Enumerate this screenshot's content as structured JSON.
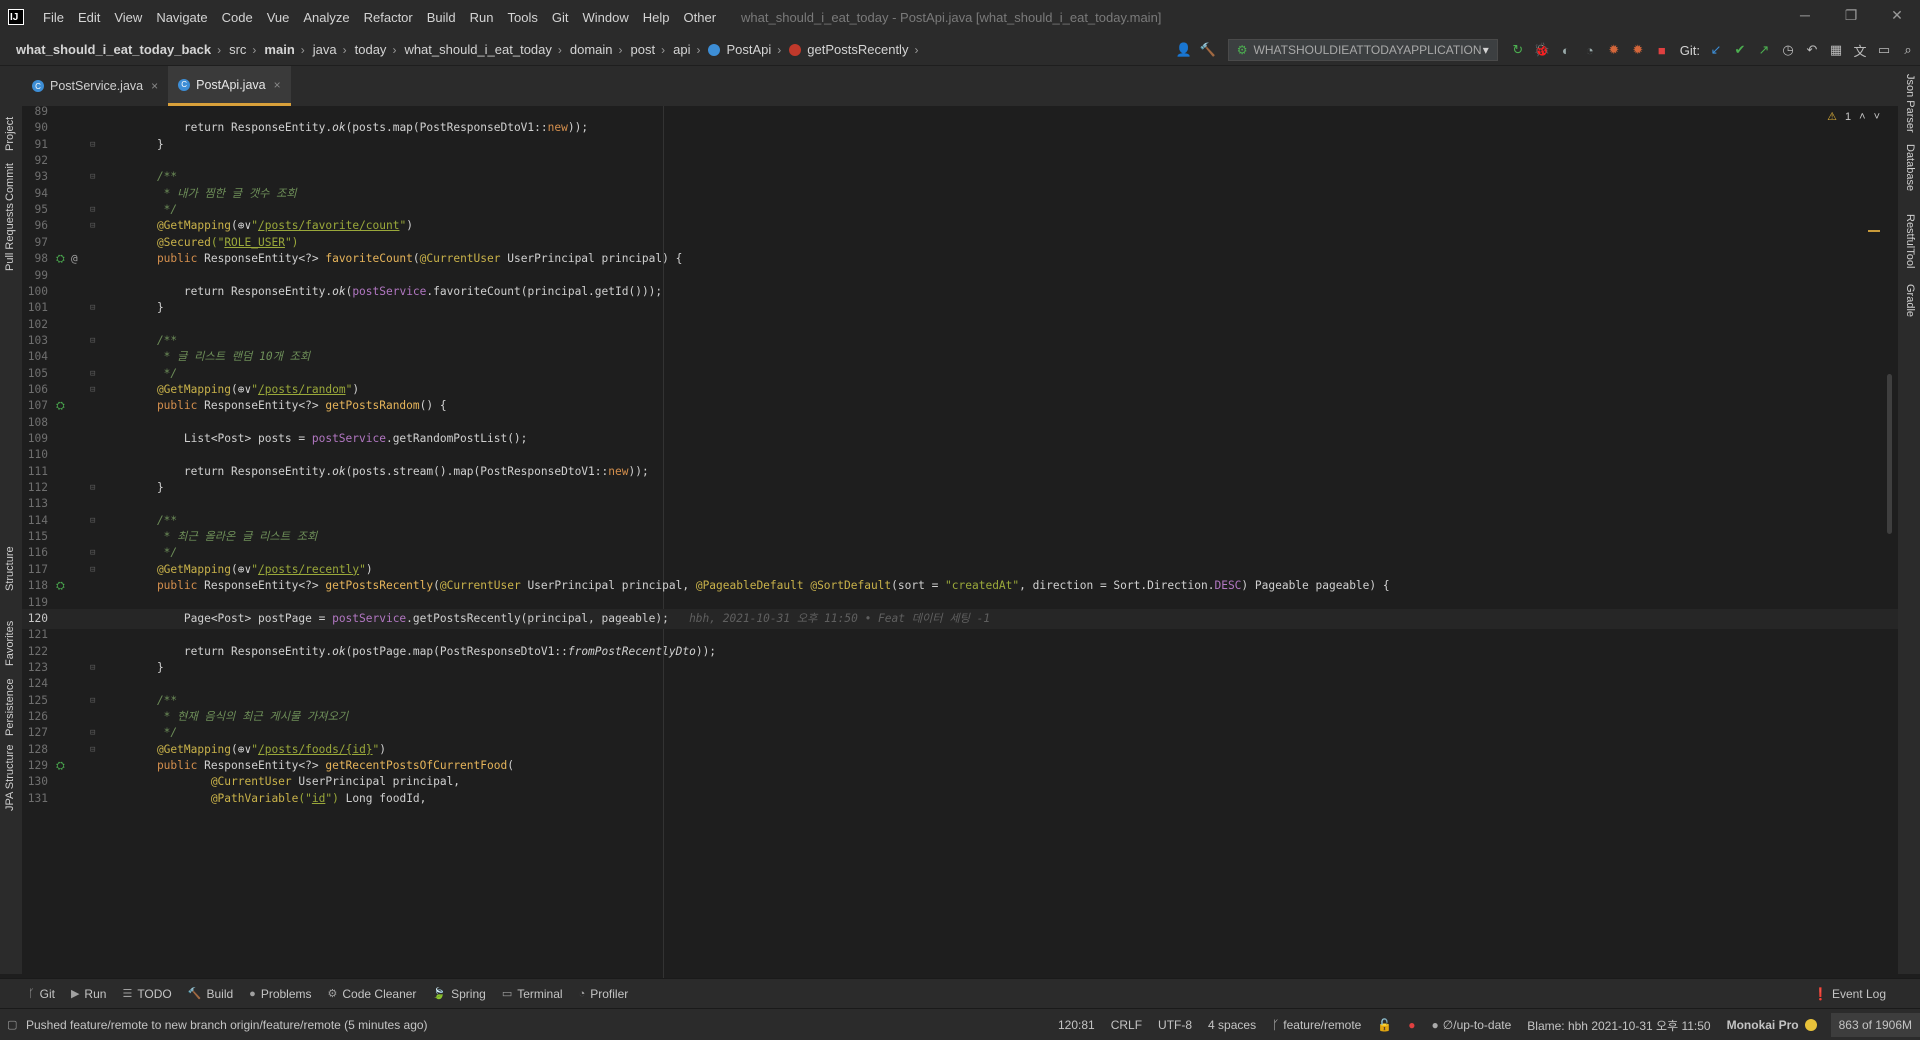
{
  "menu": {
    "items": [
      "File",
      "Edit",
      "View",
      "Navigate",
      "Code",
      "Vue",
      "Analyze",
      "Refactor",
      "Build",
      "Run",
      "Tools",
      "Git",
      "Window",
      "Help",
      "Other"
    ],
    "window_title": "what_should_i_eat_today - PostApi.java [what_should_i_eat_today.main]"
  },
  "breadcrumb": {
    "items": [
      "what_should_i_eat_today_back",
      "src",
      "main",
      "java",
      "today",
      "what_should_i_eat_today",
      "domain",
      "post",
      "api",
      "PostApi",
      "getPostsRecently"
    ]
  },
  "toolbar": {
    "run_config": "WHATSHOULDIEATTODAYAPPLICATION",
    "git_label": "Git:"
  },
  "left_strip": [
    "Project",
    "Commit",
    "Pull Requests",
    "Structure",
    "Favorites",
    "Persistence",
    "JPA Structure"
  ],
  "right_strip": [
    "Json Parser",
    "Database",
    "RestfulTool",
    "Gradle"
  ],
  "tabs": [
    {
      "label": "PostService.java",
      "active": false
    },
    {
      "label": "PostApi.java",
      "active": true
    }
  ],
  "editor": {
    "warning_count": "1",
    "lines": [
      {
        "n": "89",
        "parts": []
      },
      {
        "n": "90",
        "parts": [
          [
            "        return ResponseEntity.",
            ""
          ],
          [
            "ok",
            "k-it"
          ],
          [
            "(posts.map(PostResponseDtoV1::",
            ""
          ],
          [
            "new",
            "k-kw"
          ],
          [
            "));",
            ""
          ]
        ]
      },
      {
        "n": "91",
        "parts": [
          [
            "    }",
            ""
          ]
        ]
      },
      {
        "n": "92",
        "parts": []
      },
      {
        "n": "93",
        "parts": [
          [
            "    /**",
            "k-doc"
          ]
        ]
      },
      {
        "n": "94",
        "parts": [
          [
            "     * 내가 찜한 글 갯수 조회",
            "k-doc"
          ]
        ]
      },
      {
        "n": "95",
        "parts": [
          [
            "     */",
            "k-doc"
          ]
        ]
      },
      {
        "n": "96",
        "parts": [
          [
            "    @GetMapping",
            "k-an"
          ],
          [
            "(",
            ""
          ],
          [
            "⊕∨",
            ""
          ],
          [
            "\"",
            "k-str"
          ],
          [
            "/posts/favorite/count",
            "k-str-u"
          ],
          [
            "\"",
            "k-str"
          ],
          [
            ")",
            ""
          ]
        ]
      },
      {
        "n": "97",
        "parts": [
          [
            "    @Secured",
            "k-an"
          ],
          [
            "(\"",
            "k-str"
          ],
          [
            "ROLE_USER",
            "k-str-u"
          ],
          [
            "\")",
            "k-str"
          ]
        ]
      },
      {
        "n": "98",
        "parts": [
          [
            "    public ",
            "k-kw"
          ],
          [
            "ResponseEntity<?> ",
            ""
          ],
          [
            "favoriteCount",
            "k-fn"
          ],
          [
            "(",
            ""
          ],
          [
            "@CurrentUser ",
            "k-an"
          ],
          [
            "UserPrincipal principal) {",
            ""
          ]
        ]
      },
      {
        "n": "99",
        "parts": []
      },
      {
        "n": "100",
        "parts": [
          [
            "        return ResponseEntity.",
            ""
          ],
          [
            "ok",
            "k-it"
          ],
          [
            "(",
            ""
          ],
          [
            "postService",
            "k-fld"
          ],
          [
            ".favoriteCount(principal.getId()));",
            ""
          ]
        ]
      },
      {
        "n": "101",
        "parts": [
          [
            "    }",
            ""
          ]
        ]
      },
      {
        "n": "102",
        "parts": []
      },
      {
        "n": "103",
        "parts": [
          [
            "    /**",
            "k-doc"
          ]
        ]
      },
      {
        "n": "104",
        "parts": [
          [
            "     * 글 리스트 랜덤 10개 조회",
            "k-doc"
          ]
        ]
      },
      {
        "n": "105",
        "parts": [
          [
            "     */",
            "k-doc"
          ]
        ]
      },
      {
        "n": "106",
        "parts": [
          [
            "    @GetMapping",
            "k-an"
          ],
          [
            "(",
            ""
          ],
          [
            "⊕∨",
            ""
          ],
          [
            "\"",
            "k-str"
          ],
          [
            "/posts/random",
            "k-str-u"
          ],
          [
            "\"",
            "k-str"
          ],
          [
            ")",
            ""
          ]
        ]
      },
      {
        "n": "107",
        "parts": [
          [
            "    public ",
            "k-kw"
          ],
          [
            "ResponseEntity<?> ",
            ""
          ],
          [
            "getPostsRandom",
            "k-fn"
          ],
          [
            "() {",
            ""
          ]
        ]
      },
      {
        "n": "108",
        "parts": []
      },
      {
        "n": "109",
        "parts": [
          [
            "        List<Post> posts = ",
            ""
          ],
          [
            "postService",
            "k-fld"
          ],
          [
            ".getRandomPostList();",
            ""
          ]
        ]
      },
      {
        "n": "110",
        "parts": []
      },
      {
        "n": "111",
        "parts": [
          [
            "        return ResponseEntity.",
            ""
          ],
          [
            "ok",
            "k-it"
          ],
          [
            "(posts.stream().map(PostResponseDtoV1::",
            ""
          ],
          [
            "new",
            "k-kw"
          ],
          [
            "));",
            ""
          ]
        ]
      },
      {
        "n": "112",
        "parts": [
          [
            "    }",
            ""
          ]
        ]
      },
      {
        "n": "113",
        "parts": []
      },
      {
        "n": "114",
        "parts": [
          [
            "    /**",
            "k-doc"
          ]
        ]
      },
      {
        "n": "115",
        "parts": [
          [
            "     * 최근 올라온 글 리스트 조회",
            "k-doc"
          ]
        ]
      },
      {
        "n": "116",
        "parts": [
          [
            "     */",
            "k-doc"
          ]
        ]
      },
      {
        "n": "117",
        "parts": [
          [
            "    @GetMapping",
            "k-an"
          ],
          [
            "(",
            ""
          ],
          [
            "⊕∨",
            ""
          ],
          [
            "\"",
            "k-str"
          ],
          [
            "/posts/recently",
            "k-str-u"
          ],
          [
            "\"",
            "k-str"
          ],
          [
            ")",
            ""
          ]
        ]
      },
      {
        "n": "118",
        "parts": [
          [
            "    public ",
            "k-kw"
          ],
          [
            "ResponseEntity<?> ",
            ""
          ],
          [
            "getPostsRecently",
            "k-fn"
          ],
          [
            "(",
            ""
          ],
          [
            "@CurrentUser ",
            "k-an"
          ],
          [
            "UserPrincipal principal, ",
            ""
          ],
          [
            "@PageableDefault @SortDefault",
            "k-an"
          ],
          [
            "(sort = ",
            ""
          ],
          [
            "\"createdAt\"",
            "k-str"
          ],
          [
            ", direction = Sort.Direction.",
            ""
          ],
          [
            "DESC",
            "k-fld"
          ],
          [
            ") Pageable pageable) {",
            ""
          ]
        ]
      },
      {
        "n": "119",
        "parts": []
      },
      {
        "n": "120",
        "current": true,
        "parts": [
          [
            "        Page<Post> postPage = ",
            ""
          ],
          [
            "postService",
            "k-fld"
          ],
          [
            ".getPostsRecently(principal, pageable);",
            ""
          ],
          [
            "   hbh, 2021-10-31 오후 11:50 • Feat 데이터 세팅 -1",
            "k-blame"
          ]
        ]
      },
      {
        "n": "121",
        "parts": []
      },
      {
        "n": "122",
        "parts": [
          [
            "        return ResponseEntity.",
            ""
          ],
          [
            "ok",
            "k-it"
          ],
          [
            "(postPage.map(PostResponseDtoV1::",
            ""
          ],
          [
            "fromPostRecentlyDto",
            "k-it"
          ],
          [
            "));",
            ""
          ]
        ]
      },
      {
        "n": "123",
        "parts": [
          [
            "    }",
            ""
          ]
        ]
      },
      {
        "n": "124",
        "parts": []
      },
      {
        "n": "125",
        "parts": [
          [
            "    /**",
            "k-doc"
          ]
        ]
      },
      {
        "n": "126",
        "parts": [
          [
            "     * 현재 음식의 최근 게시물 가져오기",
            "k-doc"
          ]
        ]
      },
      {
        "n": "127",
        "parts": [
          [
            "     */",
            "k-doc"
          ]
        ]
      },
      {
        "n": "128",
        "parts": [
          [
            "    @GetMapping",
            "k-an"
          ],
          [
            "(",
            ""
          ],
          [
            "⊕∨",
            ""
          ],
          [
            "\"",
            "k-str"
          ],
          [
            "/posts/foods/{id}",
            "k-str-u"
          ],
          [
            "\"",
            "k-str"
          ],
          [
            ")",
            ""
          ]
        ]
      },
      {
        "n": "129",
        "parts": [
          [
            "    public ",
            "k-kw"
          ],
          [
            "ResponseEntity<?> ",
            ""
          ],
          [
            "getRecentPostsOfCurrentFood",
            "k-fn"
          ],
          [
            "(",
            ""
          ]
        ]
      },
      {
        "n": "130",
        "parts": [
          [
            "            @CurrentUser ",
            "k-an"
          ],
          [
            "UserPrincipal principal,",
            ""
          ]
        ]
      },
      {
        "n": "131",
        "parts": [
          [
            "            @PathVariable",
            "k-an"
          ],
          [
            "(\"",
            "k-str"
          ],
          [
            "id",
            "k-str-u"
          ],
          [
            "\") ",
            "k-str"
          ],
          [
            "Long foodId,",
            ""
          ]
        ]
      }
    ]
  },
  "tool_tabs": [
    "Git",
    "Run",
    "TODO",
    "Build",
    "Problems",
    "Code Cleaner",
    "Spring",
    "Terminal",
    "Profiler"
  ],
  "event_log": "Event Log",
  "status": {
    "message": "Pushed feature/remote to new branch origin/feature/remote (5 minutes ago)",
    "position": "120:81",
    "line_sep": "CRLF",
    "encoding": "UTF-8",
    "indent": "4 spaces",
    "branch": "feature/remote",
    "uptodate": "∅/up-to-date",
    "blame": "Blame: hbh 2021-10-31 오후 11:50",
    "theme": "Monokai Pro",
    "memory": "863 of 1906M"
  }
}
